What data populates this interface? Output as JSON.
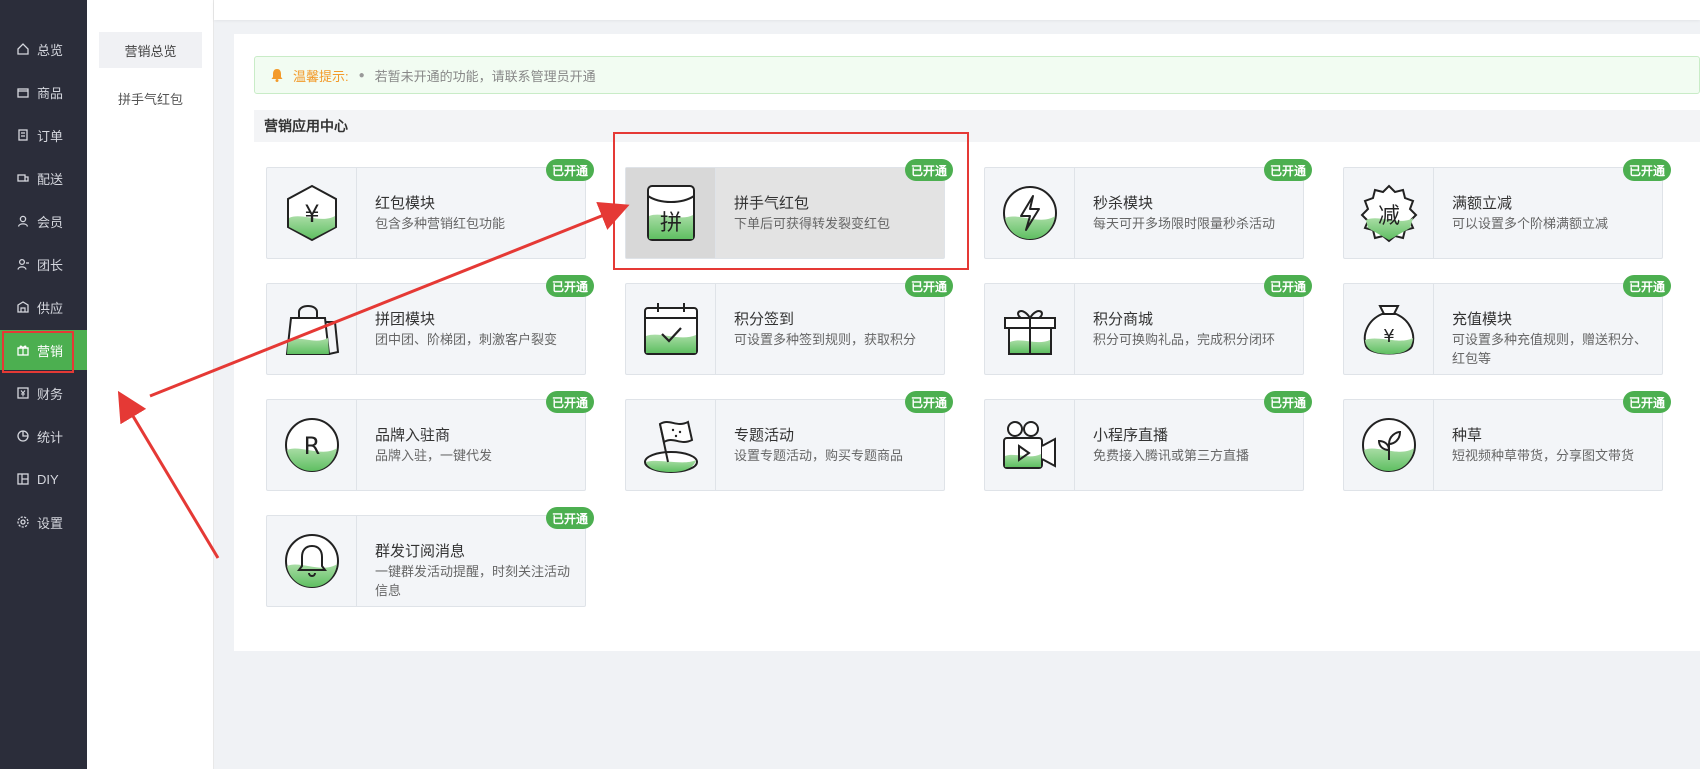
{
  "sidebar": {
    "items": [
      {
        "label": "总览",
        "icon": "home-icon"
      },
      {
        "label": "商品",
        "icon": "box-icon"
      },
      {
        "label": "订单",
        "icon": "order-icon"
      },
      {
        "label": "配送",
        "icon": "delivery-icon"
      },
      {
        "label": "会员",
        "icon": "user-icon"
      },
      {
        "label": "团长",
        "icon": "leader-icon"
      },
      {
        "label": "供应",
        "icon": "supply-icon"
      },
      {
        "label": "营销",
        "icon": "gift-icon",
        "active": true
      },
      {
        "label": "财务",
        "icon": "finance-icon"
      },
      {
        "label": "统计",
        "icon": "chart-icon"
      },
      {
        "label": "DIY",
        "icon": "layout-icon"
      },
      {
        "label": "设置",
        "icon": "gear-icon"
      }
    ]
  },
  "submenu": {
    "items": [
      {
        "label": "营销总览",
        "selected": true
      },
      {
        "label": "拼手气红包",
        "selected": false
      }
    ]
  },
  "notice": {
    "label": "温馨提示:",
    "message": "若暂未开通的功能，请联系管理员开通"
  },
  "section": {
    "title": "营销应用中心"
  },
  "cards": [
    {
      "title": "红包模块",
      "desc": "包含多种营销红包功能",
      "badge": "已开通",
      "icon": "red-packet-icon"
    },
    {
      "title": "拼手气红包",
      "desc": "下单后可获得转发裂变红包",
      "badge": "已开通",
      "icon": "lucky-packet-icon",
      "glyph": "拼"
    },
    {
      "title": "秒杀模块",
      "desc": "每天可开多场限时限量秒杀活动",
      "badge": "已开通",
      "icon": "flash-sale-icon"
    },
    {
      "title": "满额立减",
      "desc": "可以设置多个阶梯满额立减",
      "badge": "已开通",
      "icon": "discount-icon",
      "glyph": "减"
    },
    {
      "title": "拼团模块",
      "desc": "团中团、阶梯团，刺激客户裂变",
      "badge": "已开通",
      "icon": "group-buy-icon"
    },
    {
      "title": "积分签到",
      "desc": "可设置多种签到规则，获取积分",
      "badge": "已开通",
      "icon": "sign-in-icon"
    },
    {
      "title": "积分商城",
      "desc": "积分可换购礼品，完成积分闭环",
      "badge": "已开通",
      "icon": "points-mall-icon"
    },
    {
      "title": "充值模块",
      "desc": "可设置多种充值规则，赠送积分、红包等",
      "badge": "已开通",
      "icon": "recharge-icon"
    },
    {
      "title": "品牌入驻商",
      "desc": "品牌入驻，一键代发",
      "badge": "已开通",
      "icon": "brand-icon",
      "glyph": "R"
    },
    {
      "title": "专题活动",
      "desc": "设置专题活动，购买专题商品",
      "badge": "已开通",
      "icon": "topic-icon"
    },
    {
      "title": "小程序直播",
      "desc": "免费接入腾讯或第三方直播",
      "badge": "已开通",
      "icon": "live-icon"
    },
    {
      "title": "种草",
      "desc": "短视频种草带货，分享图文带货",
      "badge": "已开通",
      "icon": "seeding-icon"
    },
    {
      "title": "群发订阅消息",
      "desc": "一键群发活动提醒，时刻关注活动信息",
      "badge": "已开通",
      "icon": "subscribe-bell-icon"
    }
  ],
  "colors": {
    "sidebar_bg": "#2b2d3a",
    "accent": "#4caf50",
    "highlight": "#e53935",
    "notice_label": "#f39a2a"
  }
}
